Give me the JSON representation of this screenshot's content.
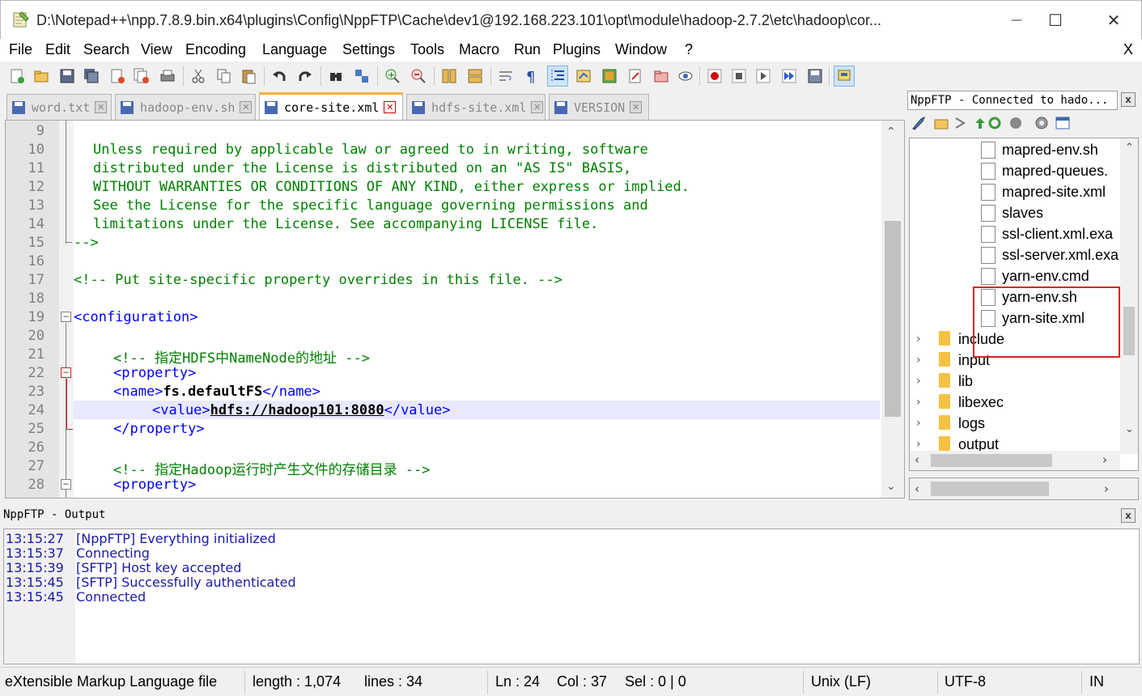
{
  "window": {
    "title": "D:\\Notepad++\\npp.7.8.9.bin.x64\\plugins\\Config\\NppFTP\\Cache\\dev1@192.168.223.101\\opt\\module\\hadoop-2.7.2\\etc\\hadoop\\cor...",
    "minimize": "—",
    "maximize": "☐",
    "close": "✕",
    "menu_close": "X"
  },
  "menu": [
    "File",
    "Edit",
    "Search",
    "View",
    "Encoding",
    "Language",
    "Settings",
    "Tools",
    "Macro",
    "Run",
    "Plugins",
    "Window",
    "?"
  ],
  "tabs": [
    {
      "label": "word.txt",
      "active": false
    },
    {
      "label": "hadoop-env.sh",
      "active": false
    },
    {
      "label": "core-site.xml",
      "active": true
    },
    {
      "label": "hdfs-site.xml",
      "active": false
    },
    {
      "label": "VERSION",
      "active": false
    }
  ],
  "editor": {
    "line_numbers": [
      "9",
      "10",
      "11",
      "12",
      "13",
      "14",
      "15",
      "16",
      "17",
      "18",
      "19",
      "20",
      "21",
      "22",
      "23",
      "24",
      "25",
      "26",
      "27",
      "28"
    ],
    "lines": {
      "l10": "Unless required by applicable law or agreed to in writing, software",
      "l11": "distributed under the License is distributed on an \"AS IS\" BASIS,",
      "l12": "WITHOUT WARRANTIES OR CONDITIONS OF ANY KIND, either express or implied.",
      "l13": "See the License for the specific language governing permissions and",
      "l14": "limitations under the License. See accompanying LICENSE file.",
      "l15": "-->",
      "l17": "<!-- Put site-specific property overrides in this file. -->",
      "l19": "<configuration>",
      "l21": "<!-- 指定HDFS中NameNode的地址 -->",
      "l22": "<property>",
      "l23_open": "<name>",
      "l23_val": "fs.defaultFS",
      "l23_close": "</name>",
      "l24_open": "<value>",
      "l24_val": "hdfs://hadoop101:8080",
      "l24_close": "</value>",
      "l25": "</property>",
      "l27": "<!-- 指定Hadoop运行时产生文件的存储目录 -->",
      "l28": "<property>"
    }
  },
  "ftp": {
    "title": "NppFTP - Connected to hado...",
    "close": "x",
    "files": [
      "mapred-env.sh",
      "mapred-queues.",
      "mapred-site.xml",
      "slaves",
      "ssl-client.xml.exa",
      "ssl-server.xml.exa",
      "yarn-env.cmd",
      "yarn-env.sh",
      "yarn-site.xml"
    ],
    "folders": [
      "include",
      "input",
      "lib",
      "libexec",
      "logs",
      "output"
    ]
  },
  "output": {
    "title": "NppFTP - Output",
    "close": "x",
    "entries": [
      {
        "time": "13:15:27",
        "msg": "[NppFTP] Everything initialized"
      },
      {
        "time": "13:15:37",
        "msg": "Connecting"
      },
      {
        "time": "13:15:39",
        "msg": "[SFTP] Host key accepted"
      },
      {
        "time": "13:15:45",
        "msg": "[SFTP] Successfully authenticated"
      },
      {
        "time": "13:15:45",
        "msg": "Connected"
      }
    ]
  },
  "status": {
    "filetype": "eXtensible Markup Language file",
    "length": "length : 1,074",
    "lines": "lines : 34",
    "ln": "Ln : 24",
    "col": "Col : 37",
    "sel": "Sel : 0 | 0",
    "eol": "Unix (LF)",
    "encoding": "UTF-8",
    "mode": "IN"
  },
  "colors": {
    "comment": "#008000",
    "tag": "#0000ff",
    "active_tab_accent": "#f7b23d",
    "highlight_box": "#e02020",
    "output_text": "#1a1aa6"
  }
}
